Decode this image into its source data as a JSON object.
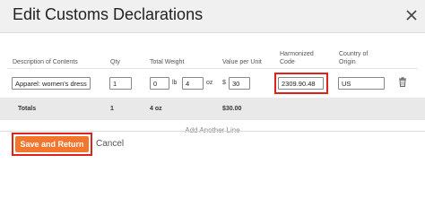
{
  "dialog": {
    "title": "Edit Customs Declarations"
  },
  "columns": {
    "description": "Description of Contents",
    "qty": "Qty",
    "weight": "Total Weight",
    "value": "Value per Unit",
    "harmonized": "Harmonized Code",
    "origin": "Country of Origin"
  },
  "line": {
    "description": "Apparel: women's dress",
    "qty": "1",
    "weight_lb": "0",
    "lb_unit": "lb",
    "weight_oz": "4",
    "oz_unit": "oz",
    "currency_symbol": "$",
    "value": "30",
    "harmonized_code": "2309.90.48",
    "origin": "US"
  },
  "totals": {
    "label": "Totals",
    "qty": "1",
    "weight": "4 oz",
    "value": "$30.00"
  },
  "add_line_label": "Add Another Line",
  "footer": {
    "save_label": "Save and Return",
    "cancel_label": "Cancel"
  },
  "colors": {
    "accent": "#f4752c",
    "highlight": "#e0221a"
  }
}
